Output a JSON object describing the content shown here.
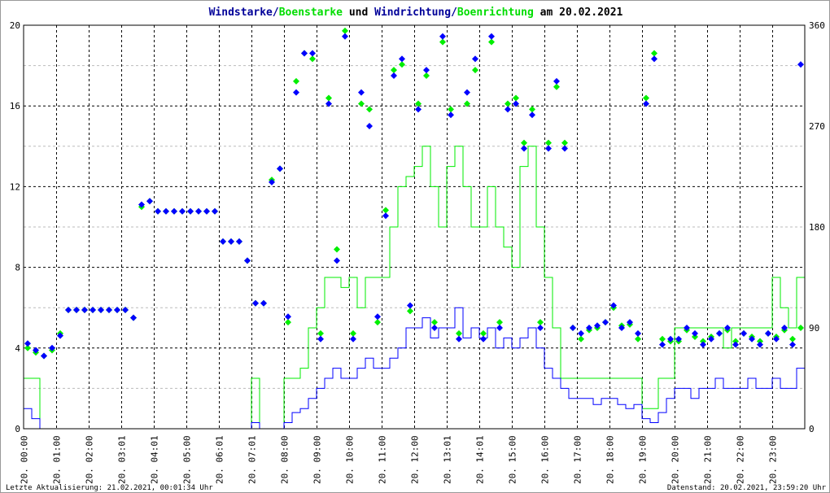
{
  "chart_data": {
    "type": "line",
    "title": {
      "part1": "Windstarke",
      "sep1": "/",
      "part2": "Boenstarke",
      "mid": " und ",
      "part3": "Windrichtung",
      "sep2": "/",
      "part4": "Boenrichtung",
      "tail": " am 20.02.2021"
    },
    "colors": {
      "wind": "#0000ff",
      "gust": "#00ee00",
      "title_dark": "#000099",
      "title_green": "#00dd00"
    },
    "ylim_left": [
      0,
      20
    ],
    "ylim_right": [
      0,
      360
    ],
    "left_ticks": [
      "0",
      "4",
      "8",
      "12",
      "16",
      "20"
    ],
    "right_ticks": [
      "0",
      "90",
      "180",
      "270",
      "360"
    ],
    "x_range_hours": [
      0,
      24
    ],
    "x_ticks": [
      "20. 00:00",
      "20. 01:00",
      "20. 02:00",
      "20. 03:01",
      "20. 04:01",
      "20. 05:00",
      "20. 06:01",
      "20. 07:01",
      "20. 08:00",
      "20. 09:00",
      "20. 10:00",
      "20. 11:00",
      "20. 12:00",
      "20. 13:01",
      "20. 14:01",
      "20. 15:00",
      "20. 16:00",
      "20. 17:00",
      "20. 18:00",
      "20. 19:00",
      "20. 20:00",
      "20. 21:00",
      "20. 22:00",
      "20. 23:00"
    ],
    "sample_step_hours": 0.25,
    "series": [
      {
        "name": "Windstarke",
        "axis": "left",
        "style": "line",
        "values": [
          1,
          0.5,
          0,
          0,
          0,
          0,
          0,
          0,
          0,
          0,
          0,
          0,
          0,
          0,
          0,
          0,
          0,
          0,
          0,
          0,
          0,
          0,
          0,
          0,
          0,
          0,
          0,
          0,
          0.3,
          0,
          0,
          0,
          0.3,
          0.8,
          1,
          1.5,
          2,
          2.5,
          3,
          2.5,
          2.5,
          3,
          3.5,
          3,
          3,
          3.5,
          4,
          5,
          5,
          5.5,
          4.5,
          5,
          5,
          6,
          4.5,
          5,
          4.5,
          5,
          4,
          4.5,
          4,
          4.5,
          5,
          4,
          3,
          2.5,
          2,
          1.5,
          1.5,
          1.5,
          1.2,
          1.5,
          1.5,
          1.2,
          1,
          1.2,
          0.5,
          0.3,
          0.8,
          1.5,
          2,
          2,
          1.5,
          2,
          2,
          2.5,
          2,
          2,
          2,
          2.5,
          2,
          2,
          2.5,
          2,
          2,
          3
        ]
      },
      {
        "name": "Boenstarke",
        "axis": "left",
        "style": "line",
        "values": [
          2.5,
          2.5,
          0,
          0,
          0,
          0,
          0,
          0,
          0,
          0,
          0,
          0,
          0,
          0,
          0,
          0,
          0,
          0,
          0,
          0,
          0,
          0,
          0,
          0,
          0,
          0,
          0,
          0,
          2.5,
          0,
          0,
          0,
          2.5,
          2.5,
          3,
          5,
          6,
          7.5,
          7.5,
          7,
          7.5,
          6,
          7.5,
          7.5,
          7.5,
          10,
          12,
          12.5,
          13,
          14,
          12,
          10,
          13,
          14,
          12,
          10,
          10,
          12,
          10,
          9,
          8,
          13,
          14,
          10,
          7.5,
          5,
          2.5,
          2.5,
          2.5,
          2.5,
          2.5,
          2.5,
          2.5,
          2.5,
          2.5,
          2.5,
          1,
          1,
          2.5,
          2.5,
          5,
          5,
          5,
          5,
          5,
          5,
          4,
          5,
          5,
          5,
          5,
          5,
          7.5,
          6,
          5,
          7.5
        ]
      },
      {
        "name": "Windrichtung",
        "axis": "right",
        "style": "diamond",
        "values": [
          76,
          70,
          65,
          72,
          83,
          106,
          106,
          106,
          106,
          106,
          106,
          106,
          106,
          99,
          200,
          203,
          194,
          194,
          194,
          194,
          194,
          194,
          194,
          194,
          167,
          167,
          167,
          150,
          112,
          112,
          220,
          232,
          100,
          300,
          335,
          335,
          80,
          290,
          150,
          350,
          80,
          300,
          270,
          100,
          190,
          315,
          330,
          110,
          285,
          320,
          90,
          350,
          280,
          80,
          300,
          330,
          80,
          350,
          90,
          285,
          290,
          250,
          280,
          90,
          250,
          310,
          250,
          90,
          85,
          90,
          92,
          95,
          110,
          90,
          95,
          85,
          290,
          330,
          75,
          80,
          80,
          90,
          85,
          75,
          80,
          85,
          90,
          75,
          85,
          80,
          75,
          85,
          80,
          90,
          75,
          325
        ]
      },
      {
        "name": "Boenrichtung",
        "axis": "right",
        "style": "diamond",
        "values": [
          72,
          68,
          65,
          70,
          85,
          106,
          106,
          106,
          106,
          106,
          106,
          106,
          106,
          99,
          198,
          203,
          194,
          194,
          194,
          194,
          194,
          194,
          194,
          194,
          167,
          167,
          167,
          150,
          112,
          112,
          222,
          232,
          95,
          310,
          335,
          330,
          85,
          295,
          160,
          355,
          85,
          290,
          285,
          95,
          195,
          320,
          325,
          105,
          290,
          315,
          95,
          345,
          285,
          85,
          290,
          320,
          85,
          345,
          95,
          290,
          295,
          255,
          285,
          95,
          255,
          305,
          255,
          90,
          80,
          88,
          90,
          95,
          108,
          92,
          93,
          80,
          295,
          335,
          80,
          78,
          78,
          88,
          82,
          78,
          82,
          85,
          88,
          78,
          85,
          82,
          78,
          85,
          82,
          88,
          80,
          90
        ]
      }
    ],
    "footer_left": "Letzte Aktualisierung: 21.02.2021, 00:01:34 Uhr",
    "footer_right": "Datenstand: 20.02.2021, 23:59:20 Uhr",
    "grid": true
  }
}
